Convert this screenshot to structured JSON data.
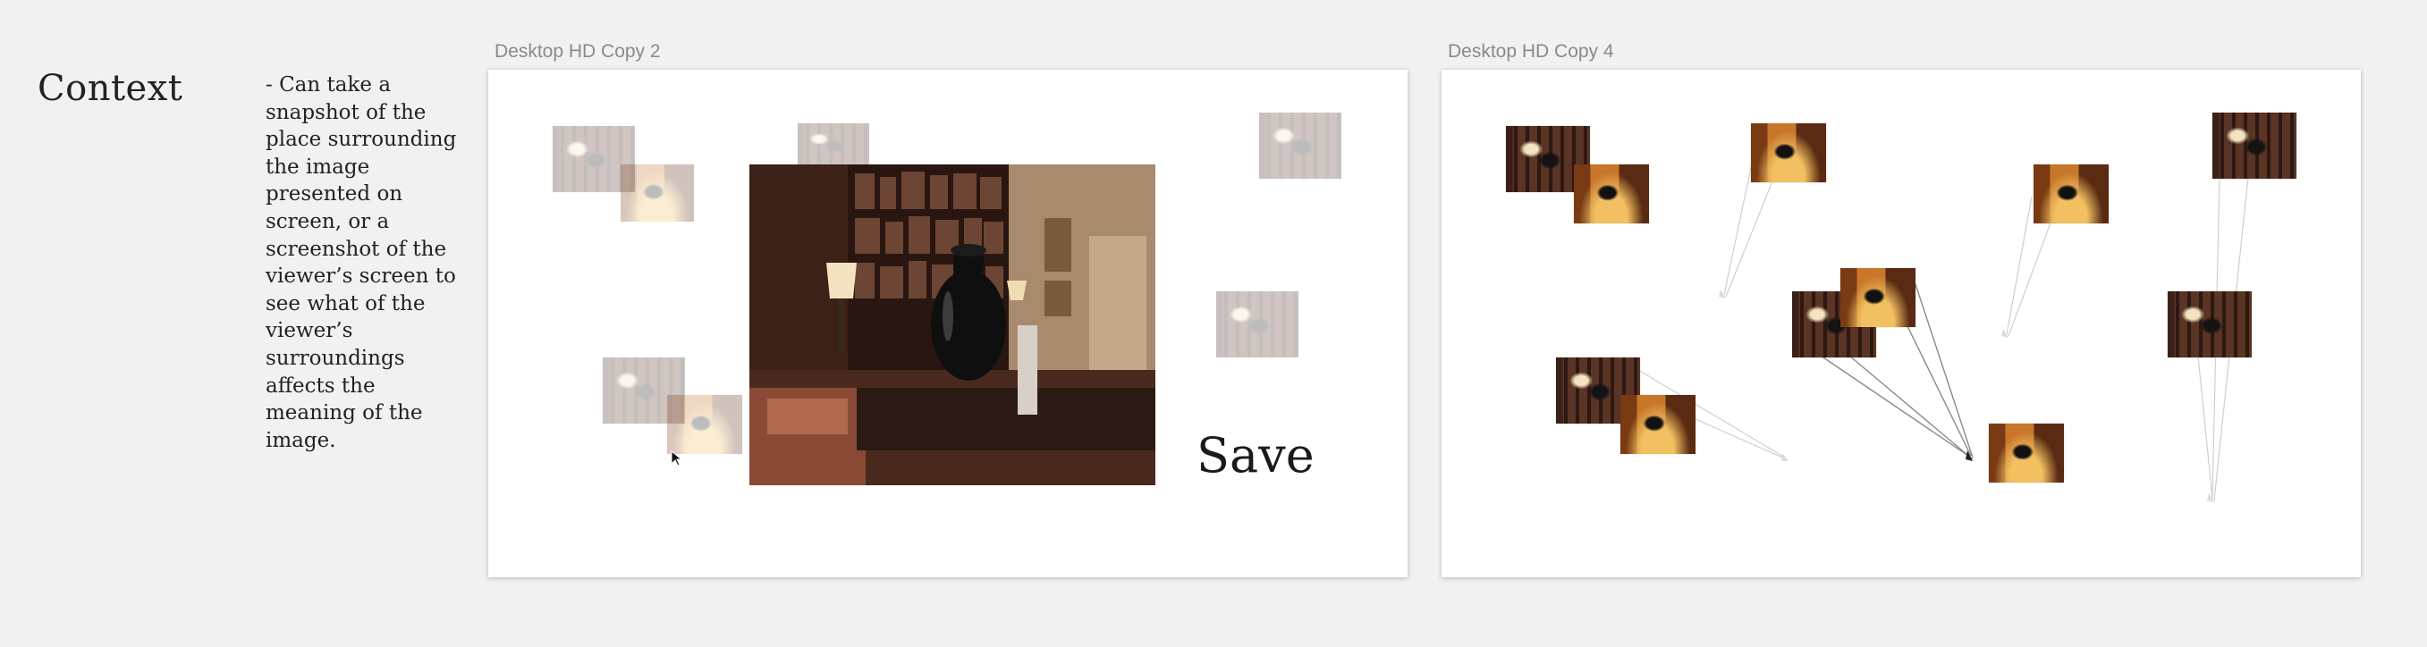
{
  "sidebar": {
    "heading": "Context",
    "notes": "- Can take a snapshot of the place surrounding the image presented on screen, or a screenshot of the viewer’s screen to see what of the viewer’s surroundings affects the meaning of the image."
  },
  "artboards": [
    {
      "label": "Desktop HD Copy 2",
      "save_text": "Save"
    },
    {
      "label": "Desktop HD Copy 4"
    }
  ],
  "colors": {
    "canvas": "#f1f1f1",
    "artboard": "#ffffff",
    "frame_label": "#8a8a8a"
  }
}
